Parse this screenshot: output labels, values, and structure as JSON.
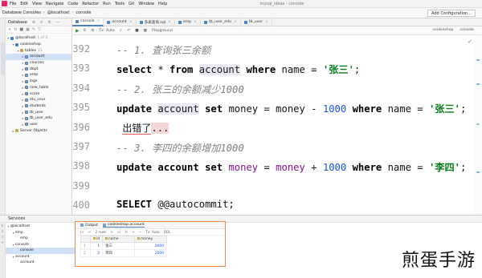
{
  "menubar": {
    "items": [
      "File",
      "Edit",
      "View",
      "Navigate",
      "Code",
      "Refactor",
      "Run",
      "Tools",
      "Git",
      "Window",
      "Help"
    ],
    "window_title": "mysql_ideas - console"
  },
  "navbar": {
    "crumbs": [
      "Database Consoles",
      "@localhost",
      "console"
    ],
    "add_config": "Add Configuration..."
  },
  "db_panel": {
    "title": "Database",
    "tree": [
      {
        "label": "@localhost",
        "sub": "1 of 5",
        "level": 0,
        "icon": "db",
        "arrow": "v"
      },
      {
        "label": "cookieshop",
        "sub": "",
        "level": 1,
        "icon": "db",
        "arrow": "v"
      },
      {
        "label": "tables",
        "sub": "11",
        "level": 2,
        "icon": "fold",
        "arrow": "v"
      },
      {
        "label": "account",
        "sub": "",
        "level": 3,
        "icon": "tbl",
        "arrow": ">",
        "selected": true
      },
      {
        "label": "courses",
        "sub": "",
        "level": 3,
        "icon": "tbl",
        "arrow": ">"
      },
      {
        "label": "dept",
        "sub": "",
        "level": 3,
        "icon": "tbl",
        "arrow": ">"
      },
      {
        "label": "emp",
        "sub": "",
        "level": 3,
        "icon": "tbl",
        "arrow": ">"
      },
      {
        "label": "logs",
        "sub": "",
        "level": 3,
        "icon": "tbl",
        "arrow": ">"
      },
      {
        "label": "new_table",
        "sub": "",
        "level": 3,
        "icon": "tbl",
        "arrow": ">"
      },
      {
        "label": "score",
        "sub": "",
        "level": 3,
        "icon": "tbl",
        "arrow": ">"
      },
      {
        "label": "stu_cour",
        "sub": "",
        "level": 3,
        "icon": "tbl",
        "arrow": ">"
      },
      {
        "label": "students",
        "sub": "",
        "level": 3,
        "icon": "tbl",
        "arrow": ">"
      },
      {
        "label": "tb_user",
        "sub": "",
        "level": 3,
        "icon": "tbl",
        "arrow": ">"
      },
      {
        "label": "tb_user_edu",
        "sub": "",
        "level": 3,
        "icon": "tbl",
        "arrow": ">"
      },
      {
        "label": "user",
        "sub": "",
        "level": 3,
        "icon": "tbl",
        "arrow": ">"
      },
      {
        "label": "Server Objects",
        "sub": "",
        "level": 1,
        "icon": "fold",
        "arrow": ">"
      }
    ]
  },
  "tabs": [
    {
      "label": "console",
      "active": true
    },
    {
      "label": "account",
      "active": false
    },
    {
      "label": "多表查询.sql",
      "active": false
    },
    {
      "label": "emp",
      "active": false
    },
    {
      "label": "tb_user_edu",
      "active": false
    },
    {
      "label": "tb_user",
      "active": false
    }
  ],
  "editor_toolbar": {
    "tx": "Tx: Auto",
    "playground": "Playground",
    "schema": "cookieshop",
    "console": "console"
  },
  "editor": {
    "lines": [
      {
        "n": "392",
        "tokens": [
          [
            "cmt",
            "-- 1. 查询张三余额"
          ]
        ]
      },
      {
        "n": "393",
        "tokens": [
          [
            "kwb",
            "select"
          ],
          [
            "",
            " * "
          ],
          [
            "kwb",
            "from"
          ],
          [
            "",
            " "
          ],
          [
            "tblh",
            "account"
          ],
          [
            "",
            " "
          ],
          [
            "kwb",
            "where"
          ],
          [
            "",
            " name = "
          ],
          [
            "str",
            "'张三'"
          ],
          [
            "",
            ";"
          ]
        ]
      },
      {
        "n": "394",
        "tokens": [
          [
            "cmt",
            "-- 2. 张三的余额减少1000"
          ]
        ]
      },
      {
        "n": "395",
        "tokens": [
          [
            "kwb",
            "update"
          ],
          [
            "",
            " "
          ],
          [
            "tblh",
            "account"
          ],
          [
            "",
            " "
          ],
          [
            "kwb",
            "set"
          ],
          [
            "",
            " money = money - "
          ],
          [
            "num",
            "1000"
          ],
          [
            "",
            " "
          ],
          [
            "kwb",
            "where"
          ],
          [
            "",
            " name = "
          ],
          [
            "str",
            "'张三'"
          ],
          [
            "",
            ";"
          ]
        ]
      },
      {
        "n": "396",
        "tokens": [
          [
            "",
            " "
          ],
          [
            "errzh",
            "出错了"
          ],
          [
            "dots",
            "..."
          ]
        ]
      },
      {
        "n": "397",
        "tokens": [
          [
            "cmt",
            "-- 3. 李四的余额增加1000"
          ]
        ]
      },
      {
        "n": "398",
        "tokens": [
          [
            "kwb",
            "update"
          ],
          [
            "",
            " "
          ],
          [
            "kwb",
            "account"
          ],
          [
            "",
            " "
          ],
          [
            "kwb",
            "set"
          ],
          [
            "",
            " "
          ],
          [
            "col",
            "money"
          ],
          [
            "",
            " = "
          ],
          [
            "col",
            "money"
          ],
          [
            "",
            " + "
          ],
          [
            "num",
            "1000"
          ],
          [
            "",
            " "
          ],
          [
            "kwb",
            "where"
          ],
          [
            "",
            " name = "
          ],
          [
            "str",
            "'李四'"
          ],
          [
            "",
            ";"
          ]
        ]
      },
      {
        "n": "399",
        "tokens": []
      },
      {
        "n": "400",
        "tokens": [
          [
            "kwb",
            "SELECT"
          ],
          [
            "",
            " @@autocommit;"
          ]
        ]
      },
      {
        "n": "401",
        "tokens": []
      }
    ]
  },
  "services": {
    "title": "Services",
    "tree": [
      {
        "label": "@localhost",
        "level": 0,
        "arrow": "v"
      },
      {
        "label": "emp",
        "level": 1,
        "arrow": "v"
      },
      {
        "label": "emp",
        "level": 2,
        "arrow": ""
      },
      {
        "label": "console",
        "level": 1,
        "arrow": "v"
      },
      {
        "label": "console",
        "level": 2,
        "arrow": "",
        "selected": true
      },
      {
        "label": "account",
        "level": 1,
        "arrow": "v"
      },
      {
        "label": "account",
        "level": 2,
        "arrow": ""
      }
    ]
  },
  "output": {
    "tabs": [
      "Output",
      "cookieshop.account"
    ],
    "rows_label": "2 rows",
    "tx": "Tx: Auto",
    "ddl": "DDL",
    "columns": [
      "id",
      "name",
      "money"
    ],
    "rows": [
      {
        "rn": "1",
        "id": "1",
        "name": "张三",
        "money": "2000"
      },
      {
        "rn": "2",
        "id": "2",
        "name": "李四",
        "money": "2000"
      }
    ]
  },
  "watermark": "煎蛋手游"
}
